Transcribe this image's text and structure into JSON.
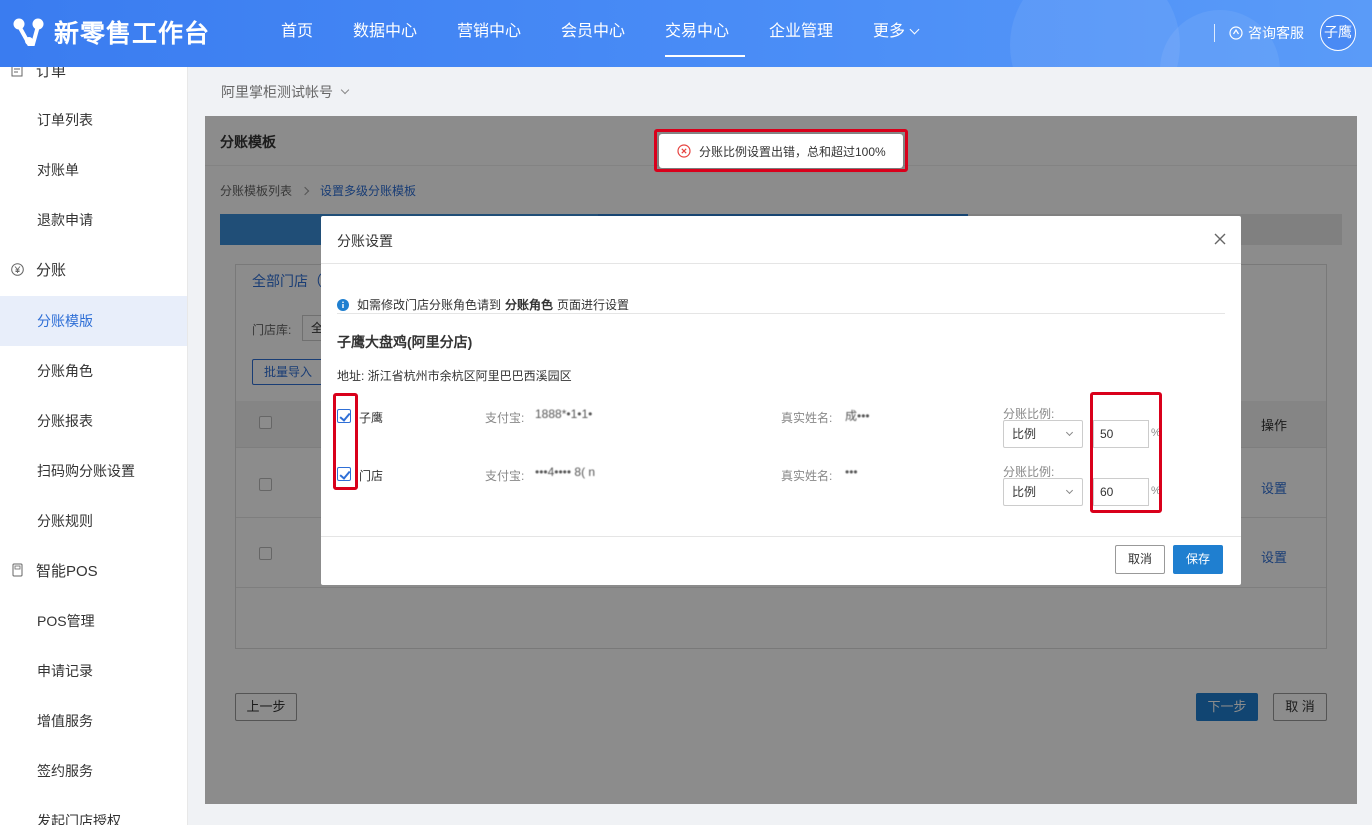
{
  "header": {
    "app_name": "新零售工作台",
    "nav": [
      "首页",
      "数据中心",
      "营销中心",
      "会员中心",
      "交易中心",
      "企业管理",
      "更多"
    ],
    "active_nav": "交易中心",
    "service_label": "咨询客服",
    "avatar_text": "子鹰",
    "accent_color": "#3a7cf0"
  },
  "sidebar": {
    "group_order": "订单",
    "items_order": [
      "订单列表",
      "对账单",
      "退款申请"
    ],
    "group_split": "分账",
    "items_split": [
      "分账模版",
      "分账角色",
      "分账报表",
      "扫码购分账设置",
      "分账规则"
    ],
    "active_item": "分账模版",
    "group_pos": "智能POS",
    "items_pos": [
      "POS管理",
      "申请记录",
      "增值服务",
      "签约服务",
      "发起门店授权"
    ]
  },
  "account": {
    "label": "阿里掌柜测试帐号"
  },
  "panel": {
    "title": "分账模板",
    "breadcrumb": [
      "分账模板列表",
      "设置多级分账模板"
    ],
    "tab_label": "全部门店（",
    "filter_label": "门店库:",
    "filter_value": "全",
    "batch_import": "批量导入",
    "op_header": "操作",
    "row_action": "设置",
    "prev_button": "上一步",
    "next_button": "下一步",
    "cancel_button": "取 消"
  },
  "toast": {
    "message": "分账比例设置出错，总和超过100%",
    "color": "#d9001b"
  },
  "modal": {
    "title": "分账设置",
    "info_prefix": "如需修改门店分账角色请到",
    "info_link": "分账角色",
    "info_suffix": "页面进行设置",
    "store_name": "子鹰大盘鸡(阿里分店)",
    "address": "地址: 浙江省杭州市余杭区阿里巴巴西溪园区",
    "alipay_label": "支付宝:",
    "realname_label": "真实姓名:",
    "ratio_label": "分账比例:",
    "ratio_unit": "%",
    "participants": [
      {
        "name": "子鹰",
        "checked": true,
        "alipay": "1888*•1•1•",
        "realname": "成•••",
        "ratio_type": "比例",
        "ratio_value": "50"
      },
      {
        "name": "门店",
        "checked": true,
        "alipay": "•••4•••• 8(     n",
        "realname": "•••",
        "ratio_type": "比例",
        "ratio_value": "60"
      }
    ],
    "cancel_button": "取消",
    "save_button": "保存"
  }
}
